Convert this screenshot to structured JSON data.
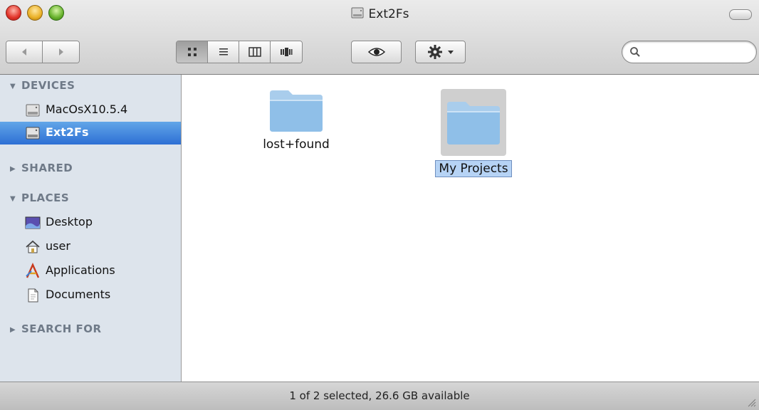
{
  "window": {
    "title": "Ext2Fs"
  },
  "toolbar": {
    "view_modes": [
      "icon-view",
      "list-view",
      "column-view",
      "cover-flow-view"
    ],
    "active_view": "icon-view",
    "search": {
      "placeholder": "",
      "value": ""
    }
  },
  "sidebar": {
    "groups": [
      {
        "header": "DEVICES",
        "expanded": true,
        "items": [
          {
            "label": "MacOsX10.5.4",
            "icon": "hard-drive-icon"
          },
          {
            "label": "Ext2Fs",
            "icon": "hard-drive-icon",
            "selected": true
          }
        ]
      },
      {
        "header": "SHARED",
        "expanded": false,
        "items": []
      },
      {
        "header": "PLACES",
        "expanded": true,
        "items": [
          {
            "label": "Desktop",
            "icon": "desktop-icon"
          },
          {
            "label": "user",
            "icon": "home-icon"
          },
          {
            "label": "Applications",
            "icon": "applications-icon"
          },
          {
            "label": "Documents",
            "icon": "documents-icon"
          }
        ]
      },
      {
        "header": "SEARCH FOR",
        "expanded": false,
        "items": []
      }
    ]
  },
  "content": {
    "items": [
      {
        "name": "lost+found",
        "selected": false
      },
      {
        "name": "My Projects",
        "selected": true,
        "renaming": true
      }
    ]
  },
  "status": {
    "text": "1 of 2 selected, 26.6 GB available"
  },
  "colors": {
    "selection": "#3d7fd9",
    "sidebar_bg": "#dde4ec",
    "folder": "#8fbfe8"
  }
}
